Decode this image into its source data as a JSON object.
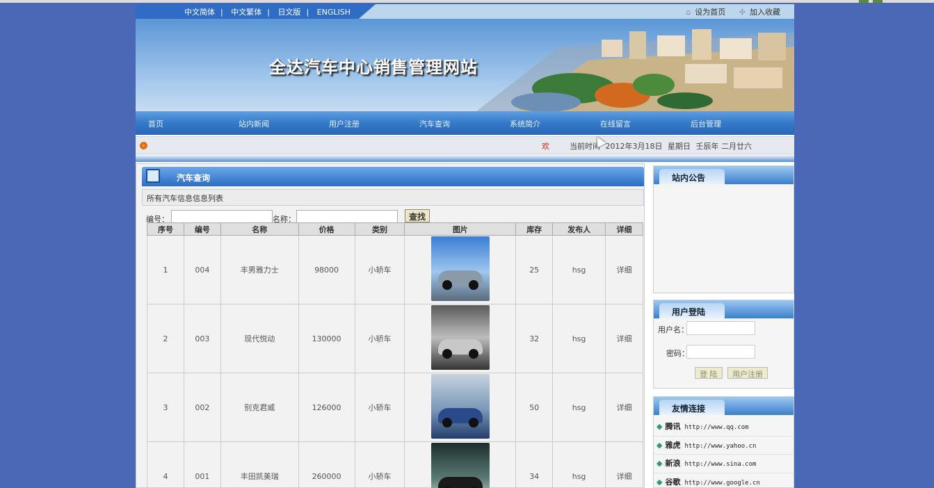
{
  "lang_links": [
    "中文简体",
    "中文繁体",
    "日文版",
    "ENGLISH"
  ],
  "lang_sep": "|",
  "top_right": {
    "set_home": "设为首页",
    "add_favorite": "加入收藏"
  },
  "site_title": "全达汽车中心销售管理网站",
  "nav": [
    "首页",
    "站内新闻",
    "用户注册",
    "汽车查询",
    "系统简介",
    "在线留言",
    "后台管理"
  ],
  "ticker": {
    "welcome": "欢",
    "time_label": "当前时间",
    "date": "2012年3月18日",
    "weekday": "星期日",
    "lunar": "壬辰年 二月廿六"
  },
  "main": {
    "header": "汽车查询",
    "subtitle": "所有汽车信息信息列表",
    "search": {
      "id_label": "编号：",
      "name_label": "名称：",
      "button": "查找"
    },
    "columns": [
      "序号",
      "编号",
      "名称",
      "价格",
      "类别",
      "图片",
      "库存",
      "发布人",
      "详细"
    ],
    "rows": [
      {
        "no": "1",
        "id": "004",
        "name": "丰男雅力士",
        "price": "98000",
        "type": "小轿车",
        "stock": "25",
        "user": "hsg",
        "detail": "详细"
      },
      {
        "no": "2",
        "id": "003",
        "name": "现代悦动",
        "price": "130000",
        "type": "小轿车",
        "stock": "32",
        "user": "hsg",
        "detail": "详细"
      },
      {
        "no": "3",
        "id": "002",
        "name": "别克君威",
        "price": "126000",
        "type": "小轿车",
        "stock": "50",
        "user": "hsg",
        "detail": "详细"
      },
      {
        "no": "4",
        "id": "001",
        "name": "丰田凯美瑞",
        "price": "260000",
        "type": "小轿车",
        "stock": "34",
        "user": "hsg",
        "detail": "详细"
      }
    ]
  },
  "notice": {
    "title": "站内公告"
  },
  "login": {
    "title": "用户登陆",
    "username_label": "用户名：",
    "password_label": "密码：",
    "login_button": "登 陆",
    "register_button": "用户注册"
  },
  "friend_links": {
    "title": "友情连接",
    "items": [
      {
        "name": "腾讯",
        "url": "http://www.qq.com"
      },
      {
        "name": "雅虎",
        "url": "http://www.yahoo.cn"
      },
      {
        "name": "新浪",
        "url": "http://www.sina.com"
      },
      {
        "name": "谷歌",
        "url": "http://www.google.cn"
      }
    ]
  }
}
